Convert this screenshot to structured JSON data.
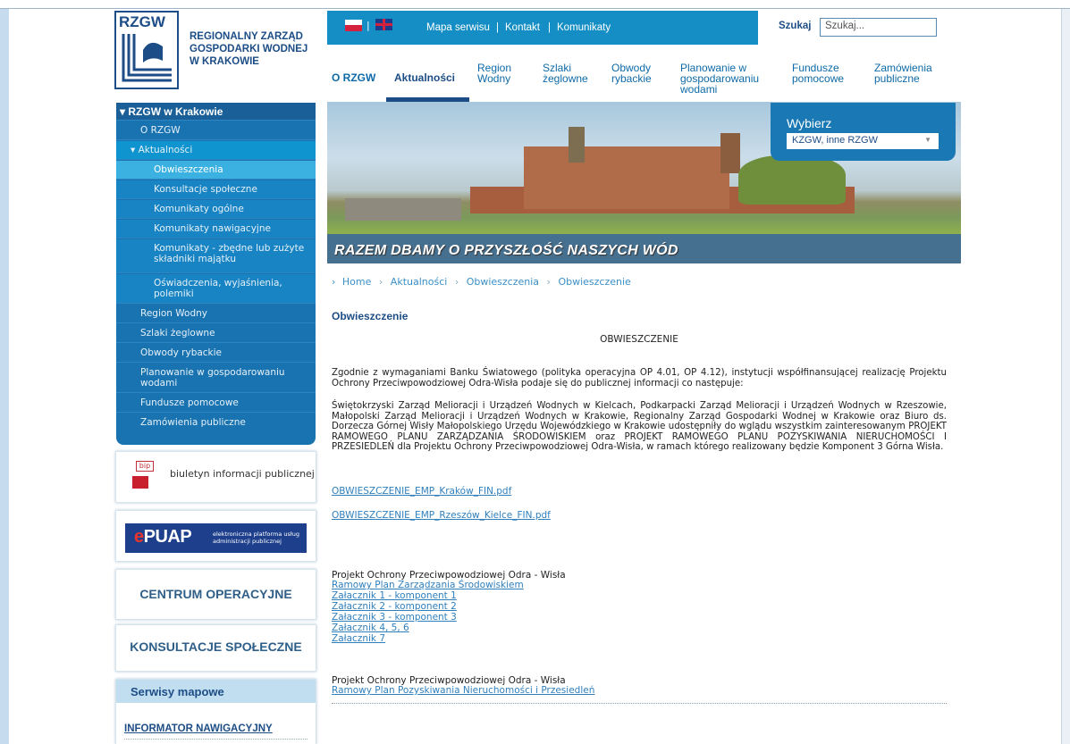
{
  "logo": {
    "abbr": "RZGW",
    "line1": "REGIONALNY ZARZĄD",
    "line2": "GOSPODARKI WODNEJ",
    "line3": "W KRAKOWIE"
  },
  "topbar": {
    "sep": "|",
    "links": [
      "Mapa serwisu",
      "Kontakt",
      "Komunikaty"
    ],
    "search_label": "Szukaj",
    "search_placeholder": "Szukaj..."
  },
  "nav": {
    "items": [
      {
        "label": "O RZGW"
      },
      {
        "label": "Aktualności"
      },
      {
        "label": "Region\nWodny"
      },
      {
        "label": "Szlaki\nżeglowne"
      },
      {
        "label": "Obwody\nrybackie"
      },
      {
        "label": "Planowanie w\ngospodarowaniu\nwodami"
      },
      {
        "label": "Fundusze\npomocowe"
      },
      {
        "label": "Zamówienia\npubliczne"
      }
    ]
  },
  "banner": {
    "caption": "RAZEM DBAMY O PRZYSZŁOŚĆ NASZYCH WÓD",
    "select_label": "Wybierz",
    "select_value": "KZGW, inne RZGW"
  },
  "sidebar": {
    "header": "RZGW w Krakowie",
    "items": [
      {
        "label": "O RZGW"
      },
      {
        "label": "Aktualności"
      },
      {
        "label": "Obwieszczenia"
      },
      {
        "label": "Konsultacje społeczne"
      },
      {
        "label": "Komunikaty ogólne"
      },
      {
        "label": "Komunikaty nawigacyjne"
      },
      {
        "label": "Komunikaty - zbędne lub zużyte składniki majątku"
      },
      {
        "label": "Oświadczenia, wyjaśnienia, polemiki"
      },
      {
        "label": "Region Wodny"
      },
      {
        "label": "Szlaki żeglowne"
      },
      {
        "label": "Obwody rybackie"
      },
      {
        "label": "Planowanie w gospodarowaniu wodami"
      },
      {
        "label": "Fundusze pomocowe"
      },
      {
        "label": "Zamówienia publiczne"
      }
    ]
  },
  "boxes": {
    "bip_icon_text": "bip",
    "bip": "biuletyn informacji publicznej",
    "epuap_logo_e": "e",
    "epuap_logo": "PUAP",
    "epuap_sub": "elektroniczna platforma usług administracji publicznej",
    "centrum": "CENTRUM OPERACYJNE",
    "konsultacje": "KONSULTACJE SPOŁECZNE",
    "serwisy_title": "Serwisy mapowe",
    "serwisy_link": "INFORMATOR NAWIGACYJNY"
  },
  "breadcrumb": {
    "sep": "›",
    "items": [
      "Home",
      "Aktualności",
      "Obwieszczenia",
      "Obwieszczenie"
    ]
  },
  "content": {
    "title": "Obwieszczenie",
    "heading": "OBWIESZCZENIE",
    "para1": "Zgodnie z wymaganiami Banku Światowego (polityka operacyjna OP 4.01, OP 4.12), instytucji współfinansującej realizację Projektu Ochrony Przeciwpowodziowej Odra-Wisła podaje się do publicznej informacji co następuje:",
    "para2": "Świętokrzyski Zarząd Melioracji i Urządzeń Wodnych w Kielcach, Podkarpacki Zarząd Melioracji i Urządzeń Wodnych w Rzeszowie, Małopolski Zarząd Melioracji i Urządzeń Wodnych w Krakowie, Regionalny Zarząd Gospodarki Wodnej w Krakowie oraz Biuro ds. Dorzecza Górnej Wisły Małopolskiego Urzędu Wojewódzkiego w Krakowie udostępniły do wglądu wszystkim zainteresowanym PROJEKT RAMOWEGO PLANU ZARZĄDZANIA ŚRODOWISKIEM oraz PROJEKT RAMOWEGO PLANU POZYSKIWANIA NIERUCHOMOŚCI I PRZESIEDLEŃ dla Projektu Ochrony Przeciwpowodziowej Odra-Wisła, w ramach którego realizowany będzie Komponent 3 Górna Wisła.",
    "file1": "OBWIESZCZENIE_EMP_Kraków_FIN.pdf",
    "file2": "OBWIESZCZENIE_EMP_Rzeszów_Kielce_FIN.pdf",
    "section1_title": "Projekt Ochrony Przeciwpowodziowej Odra - Wisła",
    "section1_links": [
      "Ramowy Plan Zarządzania Środowiskiem",
      "Załacznik 1 - komponent 1",
      "Załacznik 2 - komponent 2",
      "Załacznik 3 - komponent 3",
      "Załacznik 4, 5, 6",
      "Załacznik 7"
    ],
    "section2_title": "Projekt Ochrony Przeciwpowodziowej Odra - Wisła",
    "section2_link": "Ramowy Plan Pozyskiwania Nieruchomości i Przesiedleń"
  }
}
